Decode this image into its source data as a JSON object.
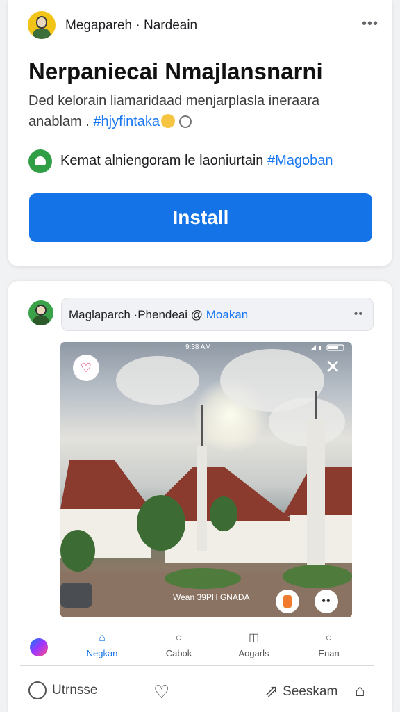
{
  "ad": {
    "page_name": "Megapareh · Nardeain",
    "more": "•••",
    "headline": "Nerpaniecai Nmajlansnarni",
    "description_line1": "Ded kelorain liamaridaad menjarplasla ineraara",
    "description_line2_prefix": "anablam . ",
    "description_hashtag": "#hjyfintaka",
    "meta_text": "Kemat alniengoram le laoniurtain ",
    "meta_hashtag": "#Magoban",
    "install_label": "Install"
  },
  "post": {
    "title_prefix": "Maglaparch ·Phendeai @ ",
    "title_mention": "Moakan",
    "more": "••",
    "status_time": "9:38 AM",
    "caption": "Wean 39PH GNADA",
    "close": "✕",
    "heart": "♡",
    "dots": "••"
  },
  "tabs": [
    {
      "label": "Negkan",
      "icon": "home-icon",
      "glyph": "⌂"
    },
    {
      "label": "Cabok",
      "icon": "search-icon",
      "glyph": "○"
    },
    {
      "label": "Aogarls",
      "icon": "camera-icon",
      "glyph": "◫"
    },
    {
      "label": "Enan",
      "icon": "search-icon",
      "glyph": "○"
    }
  ],
  "actions": {
    "like_label": "Utrnsse",
    "share_label": "Seeskam",
    "heart": "♡",
    "share": "⇗",
    "bookmark": "⌂"
  },
  "colors": {
    "accent": "#1473e6",
    "link": "#1877f2",
    "background": "#f1f2f4"
  }
}
